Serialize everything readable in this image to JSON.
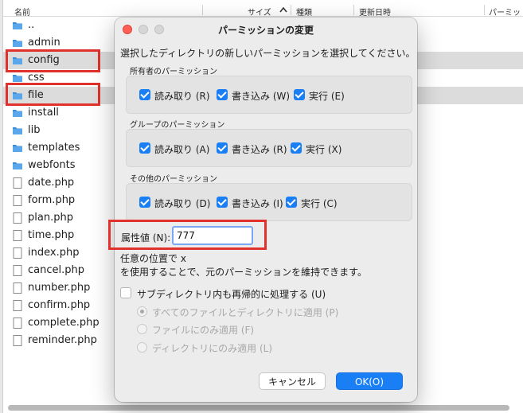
{
  "columns": {
    "name": "名前",
    "size": "サイズ",
    "type": "種類",
    "modified": "更新日時",
    "permissions": "パーミッ"
  },
  "files": [
    {
      "name": "..",
      "kind": "folder"
    },
    {
      "name": "admin",
      "kind": "folder"
    },
    {
      "name": "config",
      "kind": "folder"
    },
    {
      "name": "css",
      "kind": "folder"
    },
    {
      "name": "file",
      "kind": "folder"
    },
    {
      "name": "install",
      "kind": "folder"
    },
    {
      "name": "lib",
      "kind": "folder"
    },
    {
      "name": "templates",
      "kind": "folder"
    },
    {
      "name": "webfonts",
      "kind": "folder"
    },
    {
      "name": "date.php",
      "kind": "file"
    },
    {
      "name": "form.php",
      "kind": "file"
    },
    {
      "name": "plan.php",
      "kind": "file"
    },
    {
      "name": "time.php",
      "kind": "file"
    },
    {
      "name": "index.php",
      "kind": "file"
    },
    {
      "name": "cancel.php",
      "kind": "file"
    },
    {
      "name": "number.php",
      "kind": "file"
    },
    {
      "name": "confirm.php",
      "kind": "file"
    },
    {
      "name": "complete.php",
      "kind": "file"
    },
    {
      "name": "reminder.php",
      "kind": "file"
    }
  ],
  "dialog": {
    "title": "パーミッションの変更",
    "instruction": "選択したディレクトリの新しいパーミッションを選択してください。",
    "owner": {
      "label": "所有者のパーミッション",
      "read": "読み取り (R)",
      "write": "書き込み (W)",
      "exec": "実行 (E)"
    },
    "group": {
      "label": "グループのパーミッション",
      "read": "読み取り (A)",
      "write": "書き込み (R)",
      "exec": "実行 (X)"
    },
    "other": {
      "label": "その他のパーミッション",
      "read": "読み取り (D)",
      "write": "書き込み (I)",
      "exec": "実行 (C)"
    },
    "attr_label": "属性値 (N):",
    "attr_value": "777",
    "note_line1": "任意の位置で x",
    "note_line2": "を使用することで、元のパーミッションを維持できます。",
    "recurse_label": "サブディレクトリ内も再帰的に処理する (U)",
    "radio_all": "すべてのファイルとディレクトリに適用 (P)",
    "radio_files": "ファイルにのみ適用 (F)",
    "radio_dirs": "ディレクトリにのみ適用 (L)",
    "cancel": "キャンセル",
    "ok": "OK(O)"
  },
  "colors": {
    "accent": "#1a7ef5",
    "highlight": "#e0312c",
    "close": "#ff5f57"
  },
  "icons": {
    "folder": "folder-icon",
    "file": "document-icon",
    "sort": "sort-ascending-icon"
  }
}
